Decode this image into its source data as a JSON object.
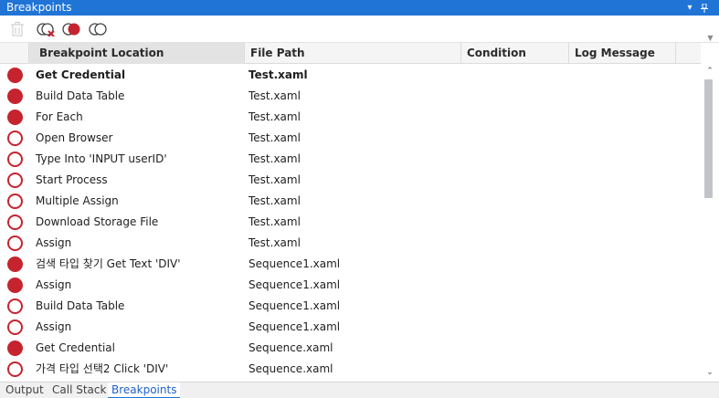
{
  "panel": {
    "title": "Breakpoints"
  },
  "toolbar": {
    "buttons": [
      {
        "icon": "trash-icon",
        "label": "delete-breakpoint"
      },
      {
        "icon": "delete-all-breakpoints-icon",
        "label": "delete-all"
      },
      {
        "icon": "enable-all-breakpoints-icon",
        "label": "enable-all"
      },
      {
        "icon": "disable-all-breakpoints-icon",
        "label": "disable-all"
      }
    ]
  },
  "columns": {
    "location": "Breakpoint Location",
    "path": "File Path",
    "condition": "Condition",
    "log": "Log Message"
  },
  "rows": [
    {
      "location": "Get Credential",
      "path": "Test.xaml",
      "enabled": true,
      "current": true
    },
    {
      "location": "Build Data Table",
      "path": "Test.xaml",
      "enabled": true
    },
    {
      "location": "For Each",
      "path": "Test.xaml",
      "enabled": true
    },
    {
      "location": "Open Browser",
      "path": "Test.xaml",
      "enabled": false
    },
    {
      "location": "Type Into 'INPUT  userID'",
      "path": "Test.xaml",
      "enabled": false
    },
    {
      "location": "Start Process",
      "path": "Test.xaml",
      "enabled": false
    },
    {
      "location": "Multiple Assign",
      "path": "Test.xaml",
      "enabled": false
    },
    {
      "location": "Download Storage File",
      "path": "Test.xaml",
      "enabled": false
    },
    {
      "location": "Assign",
      "path": "Test.xaml",
      "enabled": false
    },
    {
      "location": "검색 타입 찾기 Get Text 'DIV'",
      "path": "Sequence1.xaml",
      "enabled": true
    },
    {
      "location": "Assign",
      "path": "Sequence1.xaml",
      "enabled": true
    },
    {
      "location": "Build Data Table",
      "path": "Sequence1.xaml",
      "enabled": false
    },
    {
      "location": "Assign",
      "path": "Sequence1.xaml",
      "enabled": false
    },
    {
      "location": "Get Credential",
      "path": "Sequence.xaml",
      "enabled": true
    },
    {
      "location": "가격 타입 선택2 Click 'DIV'",
      "path": "Sequence.xaml",
      "enabled": false
    }
  ],
  "tabs": [
    "Output",
    "Call Stack",
    "Breakpoints"
  ],
  "active_tab": "Breakpoints",
  "colors": {
    "accent": "#1f74d6",
    "breakpoint": "#c5242f"
  }
}
